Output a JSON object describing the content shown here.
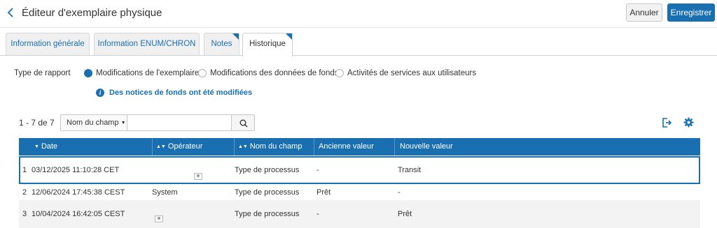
{
  "header": {
    "title": "Éditeur d'exemplaire physique",
    "cancel_label": "Annuler",
    "save_label": "Enregistrer"
  },
  "tabs": [
    {
      "label": "Information générale",
      "active": false
    },
    {
      "label": "Information ENUM/CHRON",
      "active": false
    },
    {
      "label": "Notes",
      "active": false
    },
    {
      "label": "Historique",
      "active": true
    }
  ],
  "report": {
    "label": "Type de rapport",
    "options": [
      {
        "label": "Modifications de l'exemplaire",
        "checked": true
      },
      {
        "label": "Modifications des données de fonds",
        "checked": false
      },
      {
        "label": "Activités de services aux utilisateurs",
        "checked": false
      }
    ],
    "info": "Des notices de fonds ont été modifiées"
  },
  "search": {
    "count": "1 - 7 de 7",
    "field": "Nom du champ",
    "value": ""
  },
  "table": {
    "columns": [
      "Date",
      "Opérateur",
      "Nom du champ",
      "Ancienne valeur",
      "Nouvelle valeur"
    ],
    "rows": [
      {
        "num": "1",
        "date": "03/12/2025 11:10:28 CET",
        "operator": "",
        "field": "Type de processus",
        "old": "-",
        "new": "Transit"
      },
      {
        "num": "2",
        "date": "12/06/2024 17:45:38 CEST",
        "operator": "System",
        "field": "Type de processus",
        "old": "Prêt",
        "new": "-"
      },
      {
        "num": "3",
        "date": "10/04/2024 16:42:05 CEST",
        "operator": "",
        "field": "Type de processus",
        "old": "-",
        "new": "Prêt"
      }
    ]
  },
  "icons": {
    "back": "chevron-left-icon",
    "info": "info-icon",
    "search": "search-icon",
    "export": "export-icon",
    "settings": "gear-icon",
    "user": "user-card-icon"
  },
  "colors": {
    "accent": "#1a6fb0",
    "header_row": "#1a6fb0"
  }
}
